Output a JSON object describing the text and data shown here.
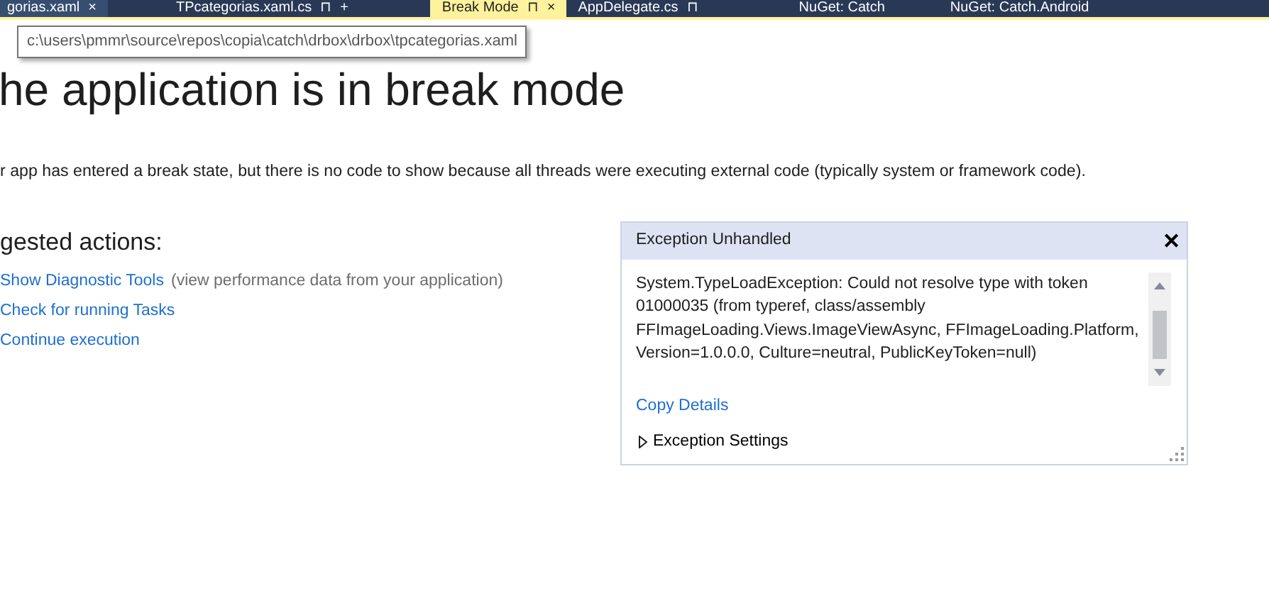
{
  "tabs": [
    {
      "label": "gorias.xaml",
      "selected": false,
      "icons": [
        "×"
      ]
    },
    {
      "label": "TPcategorias.xaml.cs",
      "selected": false,
      "icons": [
        "⊓",
        "+"
      ]
    },
    {
      "label": "Break Mode",
      "selected": true,
      "icons": [
        "⊓",
        "×"
      ]
    },
    {
      "label": "AppDelegate.cs",
      "selected": false,
      "icons": [
        "⊓"
      ]
    },
    {
      "label": "NuGet: Catch",
      "selected": false
    },
    {
      "label": "NuGet: Catch.Android",
      "selected": false
    }
  ],
  "tooltip": "c:\\users\\pmmr\\source\\repos\\copia\\catch\\drbox\\drbox\\tpcategorias.xaml",
  "heading": "he application is in break mode",
  "message": "r app has entered a break state, but there is no code to show because all threads were executing external code (typically system or framework code).",
  "suggested": {
    "title": "gested actions:",
    "actions": [
      {
        "link": "Show Diagnostic Tools",
        "note": "(view performance data from your application)"
      },
      {
        "link": "Check for running Tasks"
      },
      {
        "link": "Continue execution"
      }
    ]
  },
  "exception": {
    "title": "Exception Unhandled",
    "close": "✕",
    "text": "System.TypeLoadException: Could not resolve type with token 01000035 (from typeref, class/assembly FFImageLoading.Views.ImageViewAsync, FFImageLoading.Platform, Version=1.0.0.0, Culture=neutral, PublicKeyToken=null)",
    "copy": "Copy Details",
    "settings": {
      "label": "Exception Settings",
      "expanded": false
    }
  }
}
